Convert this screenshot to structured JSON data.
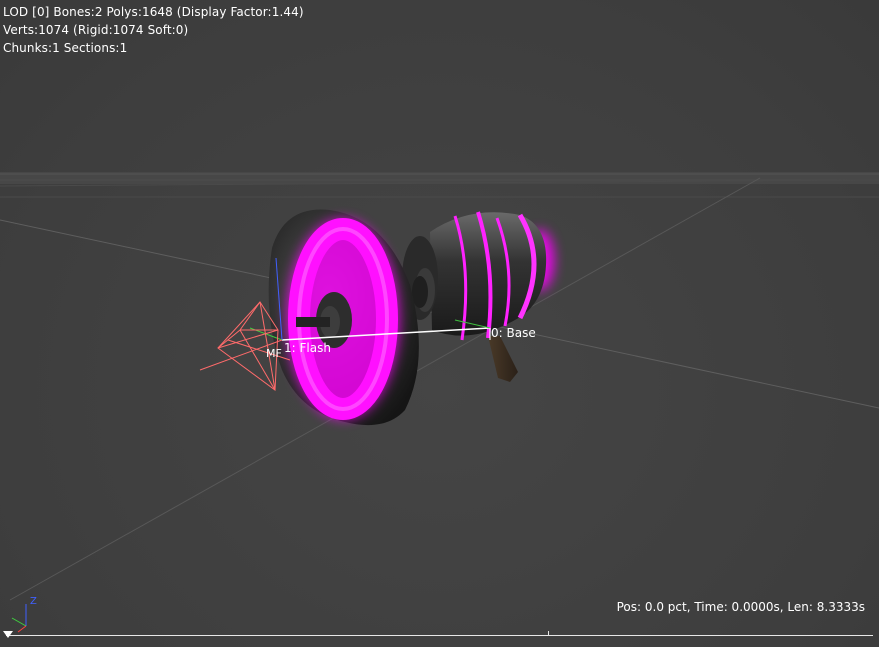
{
  "stats": {
    "line1": "LOD [0] Bones:2 Polys:1648 (Display Factor:1.44)",
    "line2": "Verts:1074 (Rigid:1074 Soft:0)",
    "line3": "Chunks:1 Sections:1"
  },
  "bones": {
    "flash_label": "1: Flash",
    "base_label": "0: Base"
  },
  "muzzle_label": "MF",
  "axis_gizmo": {
    "z_label": "Z"
  },
  "timeline": {
    "info": "Pos: 0.0 pct, Time: 0.0000s, Len: 8.3333s"
  },
  "colors": {
    "background": "#404040",
    "glow": "#ff00ff",
    "body": "#2a2a2a",
    "text": "#ffffff"
  }
}
